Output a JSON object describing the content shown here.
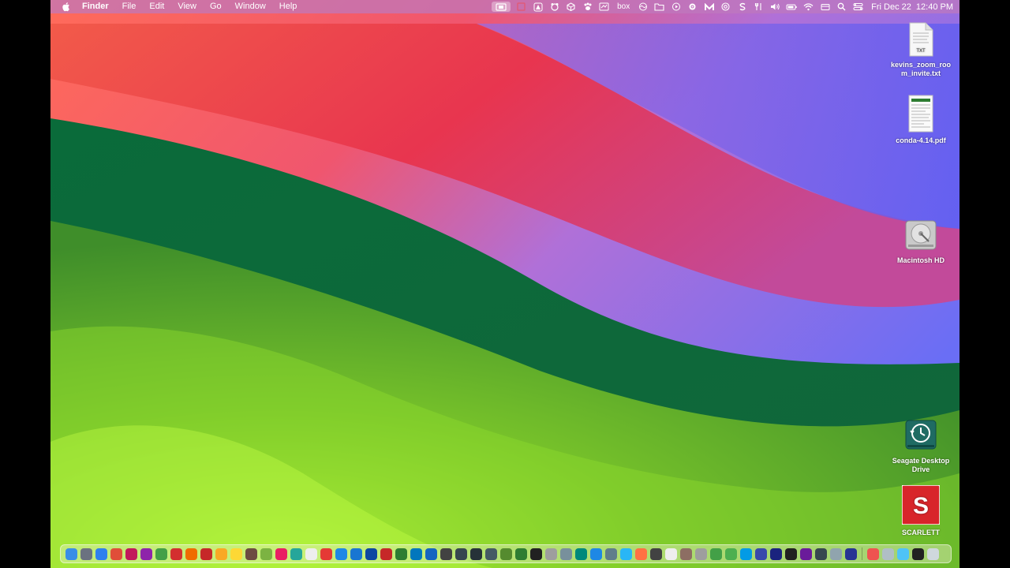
{
  "menubar": {
    "app_name": "Finder",
    "items": [
      "File",
      "Edit",
      "View",
      "Go",
      "Window",
      "Help"
    ],
    "status_icons": [
      "screen-record-icon",
      "square-icon",
      "triangle-icon",
      "bear-icon",
      "cube-icon",
      "paw-icon",
      "screenshot-icon",
      "box-icon",
      "wave-icon",
      "folder-icon",
      "play-icon",
      "gear-icon",
      "m-icon",
      "at-icon",
      "s-icon",
      "fork-icon",
      "volume-icon",
      "battery-icon",
      "wifi-icon",
      "card-icon",
      "search-icon",
      "control-center-icon"
    ],
    "box_label": "box",
    "date": "Fri Dec 22",
    "time": "12:40 PM"
  },
  "desktop_icons": [
    {
      "label": "kevins_zoom_room_invite.txt",
      "kind": "txt-file-icon",
      "badge": "TXT"
    },
    {
      "label": "conda-4.14.pdf",
      "kind": "pdf-file-icon"
    },
    {
      "label": "Macintosh HD",
      "kind": "hard-drive-icon"
    },
    {
      "label": "Seagate Desktop Drive",
      "kind": "time-machine-drive-icon"
    },
    {
      "label": "SCARLETT",
      "kind": "scarlett-drive-icon",
      "badge": "S"
    }
  ],
  "dock": {
    "colors": [
      "#3a8ee6",
      "#6b7280",
      "#2f80ed",
      "#e04e39",
      "#c2185b",
      "#8e24aa",
      "#43a047",
      "#d32f2f",
      "#ef6c00",
      "#c62828",
      "#f9a825",
      "#fdd835",
      "#6d4c41",
      "#7cb342",
      "#e91e63",
      "#26a69a",
      "#eeeeee",
      "#e53935",
      "#1e88e5",
      "#1976d2",
      "#0d47a1",
      "#c62828",
      "#2e7d32",
      "#0277bd",
      "#1565c0",
      "#424242",
      "#37474f",
      "#263238",
      "#455a64",
      "#558b2f",
      "#2e7d32",
      "#212121",
      "#9e9e9e",
      "#78909c",
      "#00897b",
      "#1e88e5",
      "#607d8b",
      "#29b6f6",
      "#ff7043",
      "#424242",
      "#eeeeee",
      "#8d6e63",
      "#9e9e9e",
      "#43a047",
      "#4caf50",
      "#039be5",
      "#3949ab",
      "#1a237e",
      "#212121",
      "#6a1b9a",
      "#37474f",
      "#90a4ae",
      "#283593",
      "#ef5350",
      "#b0bec5",
      "#4fc3f7",
      "#212121",
      "#cfd8dc"
    ]
  }
}
